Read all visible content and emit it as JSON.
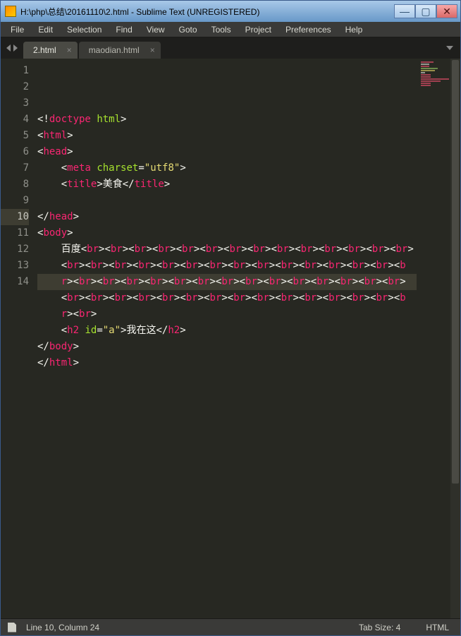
{
  "titlebar": {
    "title": "H:\\php\\总结\\20161110\\2.html - Sublime Text (UNREGISTERED)"
  },
  "menu": {
    "file": "File",
    "edit": "Edit",
    "selection": "Selection",
    "find": "Find",
    "view": "View",
    "goto": "Goto",
    "tools": "Tools",
    "project": "Project",
    "preferences": "Preferences",
    "help": "Help"
  },
  "tabs": [
    {
      "label": "2.html",
      "active": true
    },
    {
      "label": "maodian.html",
      "active": false
    }
  ],
  "window_controls": {
    "minimize": "—",
    "maximize": "▢",
    "close": "✕"
  },
  "gutter": {
    "lines": [
      "1",
      "2",
      "3",
      "4",
      "5",
      "6",
      "7",
      "8",
      "9",
      "10",
      "11",
      "12",
      "13",
      "14"
    ],
    "active_line_index": 9
  },
  "code": {
    "lines": [
      [
        {
          "c": "p",
          "t": "<!"
        },
        {
          "c": "doct",
          "t": "doctype"
        },
        {
          "c": "tx",
          "t": " "
        },
        {
          "c": "a",
          "t": "html"
        },
        {
          "c": "p",
          "t": ">"
        }
      ],
      [
        {
          "c": "p",
          "t": "<"
        },
        {
          "c": "t",
          "t": "html"
        },
        {
          "c": "p",
          "t": ">"
        }
      ],
      [
        {
          "c": "p",
          "t": "<"
        },
        {
          "c": "t",
          "t": "head"
        },
        {
          "c": "p",
          "t": ">"
        }
      ],
      [
        {
          "c": "tx",
          "t": "    "
        },
        {
          "c": "p",
          "t": "<"
        },
        {
          "c": "t",
          "t": "meta"
        },
        {
          "c": "tx",
          "t": " "
        },
        {
          "c": "a",
          "t": "charset"
        },
        {
          "c": "p",
          "t": "="
        },
        {
          "c": "s",
          "t": "\"utf8\""
        },
        {
          "c": "p",
          "t": ">"
        }
      ],
      [
        {
          "c": "tx",
          "t": "    "
        },
        {
          "c": "p",
          "t": "<"
        },
        {
          "c": "t",
          "t": "title"
        },
        {
          "c": "p",
          "t": ">"
        },
        {
          "c": "tx",
          "t": "美食"
        },
        {
          "c": "p",
          "t": "</"
        },
        {
          "c": "t",
          "t": "title"
        },
        {
          "c": "p",
          "t": ">"
        }
      ],
      [],
      [
        {
          "c": "p",
          "t": "</"
        },
        {
          "c": "t",
          "t": "head"
        },
        {
          "c": "p",
          "t": ">"
        }
      ],
      [
        {
          "c": "p",
          "t": "<"
        },
        {
          "c": "t",
          "t": "body"
        },
        {
          "c": "p",
          "t": ">"
        }
      ],
      [
        {
          "c": "tx",
          "t": "    百度"
        },
        {
          "c": "p",
          "t": "<"
        },
        {
          "c": "t",
          "t": "br"
        },
        {
          "c": "p",
          "t": "><"
        },
        {
          "c": "t",
          "t": "br"
        },
        {
          "c": "p",
          "t": "><"
        },
        {
          "c": "t",
          "t": "br"
        },
        {
          "c": "p",
          "t": "><"
        },
        {
          "c": "t",
          "t": "br"
        },
        {
          "c": "p",
          "t": "><"
        },
        {
          "c": "t",
          "t": "br"
        },
        {
          "c": "p",
          "t": "><"
        },
        {
          "c": "t",
          "t": "br"
        },
        {
          "c": "p",
          "t": "><"
        },
        {
          "c": "t",
          "t": "br"
        },
        {
          "c": "p",
          "t": "><"
        },
        {
          "c": "t",
          "t": "br"
        },
        {
          "c": "p",
          "t": "><"
        },
        {
          "c": "t",
          "t": "br"
        },
        {
          "c": "p",
          "t": "><"
        },
        {
          "c": "t",
          "t": "br"
        },
        {
          "c": "p",
          "t": "><"
        },
        {
          "c": "t",
          "t": "br"
        },
        {
          "c": "p",
          "t": "><"
        },
        {
          "c": "t",
          "t": "br"
        },
        {
          "c": "p",
          "t": "><"
        },
        {
          "c": "t",
          "t": "br"
        },
        {
          "c": "p",
          "t": "><"
        },
        {
          "c": "t",
          "t": "br"
        },
        {
          "c": "p",
          "t": "><"
        },
        {
          "c": "t",
          "t": "br"
        },
        {
          "c": "p",
          "t": "><"
        },
        {
          "c": "t",
          "t": "br"
        },
        {
          "c": "p",
          "t": "><"
        },
        {
          "c": "t",
          "t": "br"
        },
        {
          "c": "p",
          "t": "><"
        },
        {
          "c": "t",
          "t": "br"
        },
        {
          "c": "p",
          "t": "><"
        },
        {
          "c": "t",
          "t": "br"
        },
        {
          "c": "p",
          "t": "><"
        },
        {
          "c": "t",
          "t": "br"
        },
        {
          "c": "p",
          "t": "><"
        },
        {
          "c": "t",
          "t": "br"
        },
        {
          "c": "p",
          "t": "><"
        },
        {
          "c": "t",
          "t": "br"
        },
        {
          "c": "p",
          "t": "><"
        },
        {
          "c": "t",
          "t": "br"
        },
        {
          "c": "p",
          "t": "><"
        },
        {
          "c": "t",
          "t": "br"
        },
        {
          "c": "p",
          "t": "><"
        },
        {
          "c": "t",
          "t": "br"
        },
        {
          "c": "p",
          "t": "><"
        },
        {
          "c": "t",
          "t": "br"
        },
        {
          "c": "p",
          "t": "><"
        },
        {
          "c": "t",
          "t": "br"
        },
        {
          "c": "p",
          "t": "><"
        },
        {
          "c": "t",
          "t": "br"
        },
        {
          "c": "p",
          "t": "><"
        },
        {
          "c": "t",
          "t": "br"
        },
        {
          "c": "p",
          "t": "><"
        },
        {
          "c": "t",
          "t": "br"
        },
        {
          "c": "p",
          "t": "><"
        },
        {
          "c": "t",
          "t": "br"
        },
        {
          "c": "p",
          "t": "><"
        },
        {
          "c": "t",
          "t": "br"
        },
        {
          "c": "p",
          "t": "><"
        },
        {
          "c": "t",
          "t": "br"
        },
        {
          "c": "p",
          "t": "><"
        },
        {
          "c": "t",
          "t": "br"
        },
        {
          "c": "p",
          "t": "><"
        },
        {
          "c": "t",
          "t": "br"
        },
        {
          "c": "p",
          "t": "><"
        },
        {
          "c": "t",
          "t": "br"
        },
        {
          "c": "p",
          "t": "><"
        },
        {
          "c": "t",
          "t": "br"
        },
        {
          "c": "p",
          "t": "><"
        },
        {
          "c": "t",
          "t": "br"
        },
        {
          "c": "p",
          "t": "><"
        },
        {
          "c": "t",
          "t": "br"
        },
        {
          "c": "p",
          "t": "><"
        },
        {
          "c": "t",
          "t": "br"
        },
        {
          "c": "p",
          "t": "><"
        },
        {
          "c": "t",
          "t": "br"
        },
        {
          "c": "p",
          "t": "><"
        },
        {
          "c": "t",
          "t": "br"
        },
        {
          "c": "p",
          "t": "><"
        },
        {
          "c": "t",
          "t": "br"
        },
        {
          "c": "p",
          "t": "><"
        },
        {
          "c": "t",
          "t": "br"
        },
        {
          "c": "p",
          "t": "><"
        },
        {
          "c": "t",
          "t": "br"
        },
        {
          "c": "p",
          "t": "><"
        },
        {
          "c": "t",
          "t": "br"
        },
        {
          "c": "p",
          "t": "><"
        },
        {
          "c": "t",
          "t": "br"
        },
        {
          "c": "p",
          "t": "><"
        },
        {
          "c": "t",
          "t": "br"
        },
        {
          "c": "p",
          "t": "><"
        },
        {
          "c": "t",
          "t": "br"
        },
        {
          "c": "p",
          "t": "><"
        },
        {
          "c": "t",
          "t": "br"
        },
        {
          "c": "p",
          "t": "><"
        },
        {
          "c": "t",
          "t": "br"
        },
        {
          "c": "p",
          "t": "><"
        },
        {
          "c": "t",
          "t": "br"
        },
        {
          "c": "p",
          "t": "><"
        },
        {
          "c": "t",
          "t": "br"
        },
        {
          "c": "p",
          "t": "><"
        },
        {
          "c": "t",
          "t": "br"
        },
        {
          "c": "p",
          "t": "><"
        },
        {
          "c": "t",
          "t": "br"
        },
        {
          "c": "p",
          "t": "><"
        },
        {
          "c": "t",
          "t": "br"
        },
        {
          "c": "p",
          "t": "><"
        },
        {
          "c": "t",
          "t": "br"
        },
        {
          "c": "p",
          "t": "><"
        },
        {
          "c": "t",
          "t": "br"
        },
        {
          "c": "p",
          "t": "><"
        },
        {
          "c": "t",
          "t": "br"
        },
        {
          "c": "p",
          "t": ">"
        }
      ],
      [
        {
          "c": "tx",
          "t": "    "
        },
        {
          "c": "p",
          "t": "<"
        },
        {
          "c": "t",
          "t": "h2"
        },
        {
          "c": "tx",
          "t": " "
        },
        {
          "c": "a",
          "t": "id"
        },
        {
          "c": "p",
          "t": "="
        },
        {
          "c": "s",
          "t": "\"a\""
        },
        {
          "c": "p",
          "t": ">"
        },
        {
          "c": "tx",
          "t": "我在这"
        },
        {
          "c": "p",
          "t": "</"
        },
        {
          "c": "t",
          "t": "h2"
        },
        {
          "c": "p",
          "t": ">"
        }
      ],
      [
        {
          "c": "p",
          "t": "</"
        },
        {
          "c": "t",
          "t": "body"
        },
        {
          "c": "p",
          "t": ">"
        }
      ],
      [
        {
          "c": "p",
          "t": "</"
        },
        {
          "c": "t",
          "t": "html"
        },
        {
          "c": "p",
          "t": ">"
        }
      ],
      [],
      []
    ],
    "wrap_width_chars": 62,
    "wrap_indent": "    "
  },
  "statusbar": {
    "position": "Line 10, Column 24",
    "tab_size": "Tab Size: 4",
    "syntax": "HTML"
  }
}
